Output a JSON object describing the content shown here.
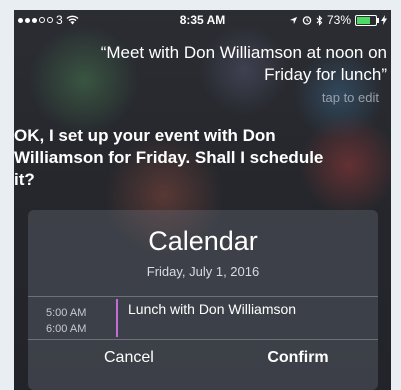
{
  "status_bar": {
    "carrier": "3",
    "time": "8:35 AM",
    "battery_percent_label": "73%",
    "battery_level": 0.73
  },
  "siri": {
    "query": "“Meet with Don Williamson at noon on Friday for lunch”",
    "tap_to_edit": "tap to edit",
    "response": "OK, I set up your event with Don Williamson for Friday. Shall I schedule it?"
  },
  "calendar_card": {
    "title": "Calendar",
    "date": "Friday, July 1, 2016",
    "event": {
      "start": "5:00 AM",
      "end": "6:00 AM",
      "title": "Lunch with Don Williamson",
      "color": "#c56bd6"
    },
    "cancel_label": "Cancel",
    "confirm_label": "Confirm"
  }
}
